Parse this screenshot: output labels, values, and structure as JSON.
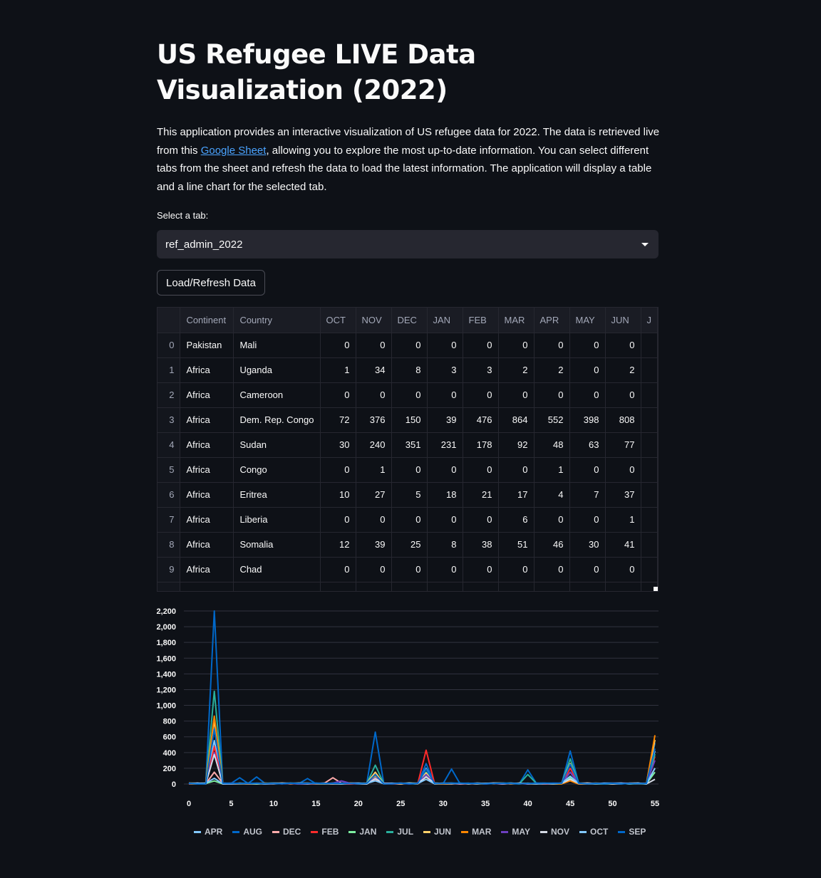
{
  "header": {
    "title": "US Refugee LIVE Data Visualization (2022)",
    "intro_before_link": "This application provides an interactive visualization of US refugee data for 2022. The data is retrieved live from this ",
    "intro_link": "Google Sheet",
    "intro_after_link": ", allowing you to explore the most up-to-date information. You can select different tabs from the sheet and refresh the data to load the latest information. The application will display a table and a line chart for the selected tab."
  },
  "controls": {
    "select_label": "Select a tab:",
    "selected_tab": "ref_admin_2022",
    "refresh_button": "Load/Refresh Data"
  },
  "table": {
    "columns": [
      "Continent",
      "Country",
      "OCT",
      "NOV",
      "DEC",
      "JAN",
      "FEB",
      "MAR",
      "APR",
      "MAY",
      "JUN",
      "J"
    ],
    "rows": [
      {
        "index": "0",
        "continent": "Pakistan",
        "country": "Mali",
        "values": [
          "0",
          "0",
          "0",
          "0",
          "0",
          "0",
          "0",
          "0",
          "0"
        ]
      },
      {
        "index": "1",
        "continent": "Africa",
        "country": "Uganda",
        "values": [
          "1",
          "34",
          "8",
          "3",
          "3",
          "2",
          "2",
          "0",
          "2"
        ]
      },
      {
        "index": "2",
        "continent": "Africa",
        "country": "Cameroon",
        "values": [
          "0",
          "0",
          "0",
          "0",
          "0",
          "0",
          "0",
          "0",
          "0"
        ]
      },
      {
        "index": "3",
        "continent": "Africa",
        "country": "Dem. Rep. Congo",
        "values": [
          "72",
          "376",
          "150",
          "39",
          "476",
          "864",
          "552",
          "398",
          "808"
        ]
      },
      {
        "index": "4",
        "continent": "Africa",
        "country": "Sudan",
        "values": [
          "30",
          "240",
          "351",
          "231",
          "178",
          "92",
          "48",
          "63",
          "77"
        ]
      },
      {
        "index": "5",
        "continent": "Africa",
        "country": "Congo",
        "values": [
          "0",
          "1",
          "0",
          "0",
          "0",
          "0",
          "1",
          "0",
          "0"
        ]
      },
      {
        "index": "6",
        "continent": "Africa",
        "country": "Eritrea",
        "values": [
          "10",
          "27",
          "5",
          "18",
          "21",
          "17",
          "4",
          "7",
          "37"
        ]
      },
      {
        "index": "7",
        "continent": "Africa",
        "country": "Liberia",
        "values": [
          "0",
          "0",
          "0",
          "0",
          "0",
          "6",
          "0",
          "0",
          "1"
        ]
      },
      {
        "index": "8",
        "continent": "Africa",
        "country": "Somalia",
        "values": [
          "12",
          "39",
          "25",
          "8",
          "38",
          "51",
          "46",
          "30",
          "41"
        ]
      },
      {
        "index": "9",
        "continent": "Africa",
        "country": "Chad",
        "values": [
          "0",
          "0",
          "0",
          "0",
          "0",
          "0",
          "0",
          "0",
          "0"
        ]
      }
    ]
  },
  "chart_data": {
    "type": "line",
    "xlim": [
      0,
      55
    ],
    "ylim": [
      0,
      2200
    ],
    "x_ticks": [
      "0",
      "5",
      "10",
      "15",
      "20",
      "25",
      "30",
      "35",
      "40",
      "45",
      "50",
      "55"
    ],
    "y_ticks": [
      "0",
      "200",
      "400",
      "600",
      "800",
      "1,000",
      "1,200",
      "1,400",
      "1,600",
      "1,800",
      "2,000",
      "2,200"
    ],
    "legend_position": "bottom",
    "series": [
      {
        "name": "APR",
        "color": "#83c9ff",
        "peaks": [
          [
            3,
            552
          ],
          [
            22,
            80
          ],
          [
            28,
            200
          ],
          [
            45,
            150
          ],
          [
            55,
            420
          ]
        ]
      },
      {
        "name": "AUG",
        "color": "#0068c9",
        "peaks": [
          [
            3,
            2200
          ],
          [
            6,
            80
          ],
          [
            8,
            90
          ],
          [
            14,
            70
          ],
          [
            22,
            660
          ],
          [
            28,
            260
          ],
          [
            31,
            190
          ],
          [
            40,
            180
          ],
          [
            45,
            420
          ],
          [
            55,
            520
          ]
        ]
      },
      {
        "name": "DEC",
        "color": "#ffabab",
        "peaks": [
          [
            3,
            150
          ],
          [
            17,
            80
          ],
          [
            22,
            60
          ],
          [
            28,
            100
          ],
          [
            45,
            60
          ],
          [
            55,
            200
          ]
        ]
      },
      {
        "name": "FEB",
        "color": "#ff2b2b",
        "peaks": [
          [
            3,
            476
          ],
          [
            22,
            120
          ],
          [
            28,
            430
          ],
          [
            45,
            200
          ],
          [
            55,
            350
          ]
        ]
      },
      {
        "name": "JAN",
        "color": "#7defa1",
        "peaks": [
          [
            3,
            39
          ],
          [
            22,
            90
          ],
          [
            28,
            110
          ],
          [
            45,
            80
          ],
          [
            55,
            150
          ]
        ]
      },
      {
        "name": "JUL",
        "color": "#29b09d",
        "peaks": [
          [
            3,
            1180
          ],
          [
            22,
            240
          ],
          [
            28,
            150
          ],
          [
            40,
            120
          ],
          [
            45,
            320
          ],
          [
            55,
            380
          ]
        ]
      },
      {
        "name": "JUN",
        "color": "#ffd16a",
        "peaks": [
          [
            3,
            808
          ],
          [
            22,
            150
          ],
          [
            28,
            140
          ],
          [
            45,
            260
          ],
          [
            55,
            560
          ]
        ]
      },
      {
        "name": "MAR",
        "color": "#ff8700",
        "peaks": [
          [
            3,
            864
          ],
          [
            22,
            110
          ],
          [
            28,
            90
          ],
          [
            45,
            40
          ],
          [
            55,
            620
          ]
        ]
      },
      {
        "name": "MAY",
        "color": "#6d3fc0",
        "peaks": [
          [
            3,
            398
          ],
          [
            18,
            40
          ],
          [
            22,
            80
          ],
          [
            28,
            120
          ],
          [
            45,
            150
          ],
          [
            55,
            300
          ]
        ]
      },
      {
        "name": "NOV",
        "color": "#d5dae5",
        "peaks": [
          [
            3,
            376
          ],
          [
            22,
            70
          ],
          [
            28,
            90
          ],
          [
            45,
            60
          ],
          [
            55,
            60
          ]
        ]
      },
      {
        "name": "OCT",
        "color": "#83c9ff",
        "peaks": [
          [
            3,
            72
          ],
          [
            22,
            40
          ],
          [
            28,
            60
          ],
          [
            45,
            100
          ],
          [
            55,
            200
          ]
        ]
      },
      {
        "name": "SEP",
        "color": "#0068c9",
        "peaks": [
          [
            3,
            700
          ],
          [
            22,
            120
          ],
          [
            28,
            190
          ],
          [
            45,
            250
          ],
          [
            55,
            450
          ]
        ]
      }
    ]
  }
}
